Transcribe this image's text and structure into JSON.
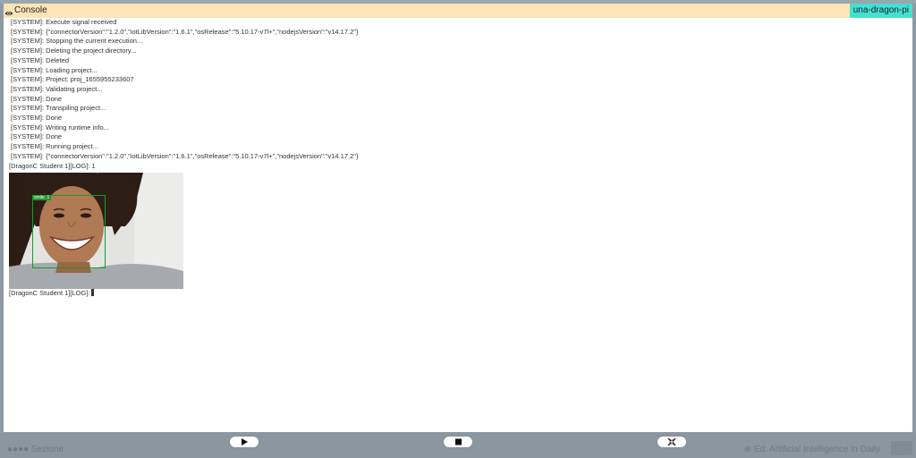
{
  "console": {
    "title": "Console",
    "device": "una-dragon-pi",
    "logs_before_image": [
      "[SYSTEM]: Execute signal received",
      "[SYSTEM]: {\"connectorVersion\":\"1.2.0\",\"iotLibVersion\":\"1.6.1\",\"osRelease\":\"5.10.17-v7l+\",\"nodejsVersion\":\"v14.17.2\"}",
      "[SYSTEM]: Stopping the current execution...",
      "[SYSTEM]: Deleting the project directory...",
      "[SYSTEM]: Deleted",
      "[SYSTEM]: Loading project...",
      "[SYSTEM]: Project: proj_1655955233607",
      "[SYSTEM]: Validating project...",
      "[SYSTEM]: Done",
      "[SYSTEM]: Transpiling project...",
      "[SYSTEM]: Done",
      "[SYSTEM]: Writing runtime info...",
      "[SYSTEM]: Done",
      "[SYSTEM]: Running project...",
      "[SYSTEM]: {\"connectorVersion\":\"1.2.0\",\"iotLibVersion\":\"1.6.1\",\"osRelease\":\"5.10.17-v7l+\",\"nodejsVersion\":\"v14.17.2\"}",
      "[DragonC Student 1][LOG]: 1"
    ],
    "detection_label": "smile: 1",
    "log_after_image": "[DragonC Student 1][LOG]:"
  },
  "controls": {
    "play_icon": "play-icon",
    "stop_icon": "stop-icon",
    "collapse_icon": "collapse-icon"
  },
  "background": {
    "bottom_left": "●●●●   Sezione",
    "bottom_right": "⊕ Ed: Artificial Intelligence in Daily"
  },
  "colors": {
    "header": "#fde4b8",
    "badge": "#45e0d0",
    "detect": "#1a9a2a"
  }
}
